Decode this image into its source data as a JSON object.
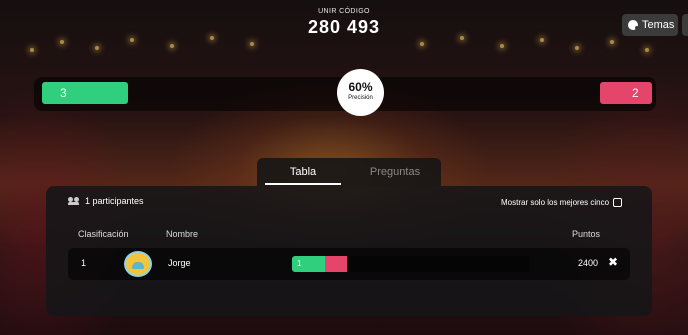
{
  "join": {
    "label": "UNIR CÓDIGO",
    "code": "280 493"
  },
  "themes_button": {
    "label": "Temas",
    "icon": "palette-icon"
  },
  "scoreboard": {
    "correct_count": "3",
    "incorrect_count": "2",
    "accuracy_percent": "60%",
    "accuracy_label": "Precisión",
    "colors": {
      "correct": "#2fcf7e",
      "incorrect": "#e5456b"
    }
  },
  "tabs": [
    {
      "label": "Tabla",
      "active": true
    },
    {
      "label": "Preguntas",
      "active": false
    }
  ],
  "leaderboard": {
    "participants_label": "1 participantes",
    "top_five_label": "Mostrar solo los mejores cinco",
    "top_five_checked": false,
    "columns": {
      "rank": "Clasificación",
      "name": "Nombre",
      "points": "Puntos"
    },
    "rows": [
      {
        "rank": "1",
        "name": "Jorge",
        "correct_label": "1",
        "correct_fraction": 0.6,
        "incorrect_fraction": 0.4,
        "answered_fraction": 0.23,
        "points": "2400"
      }
    ]
  }
}
